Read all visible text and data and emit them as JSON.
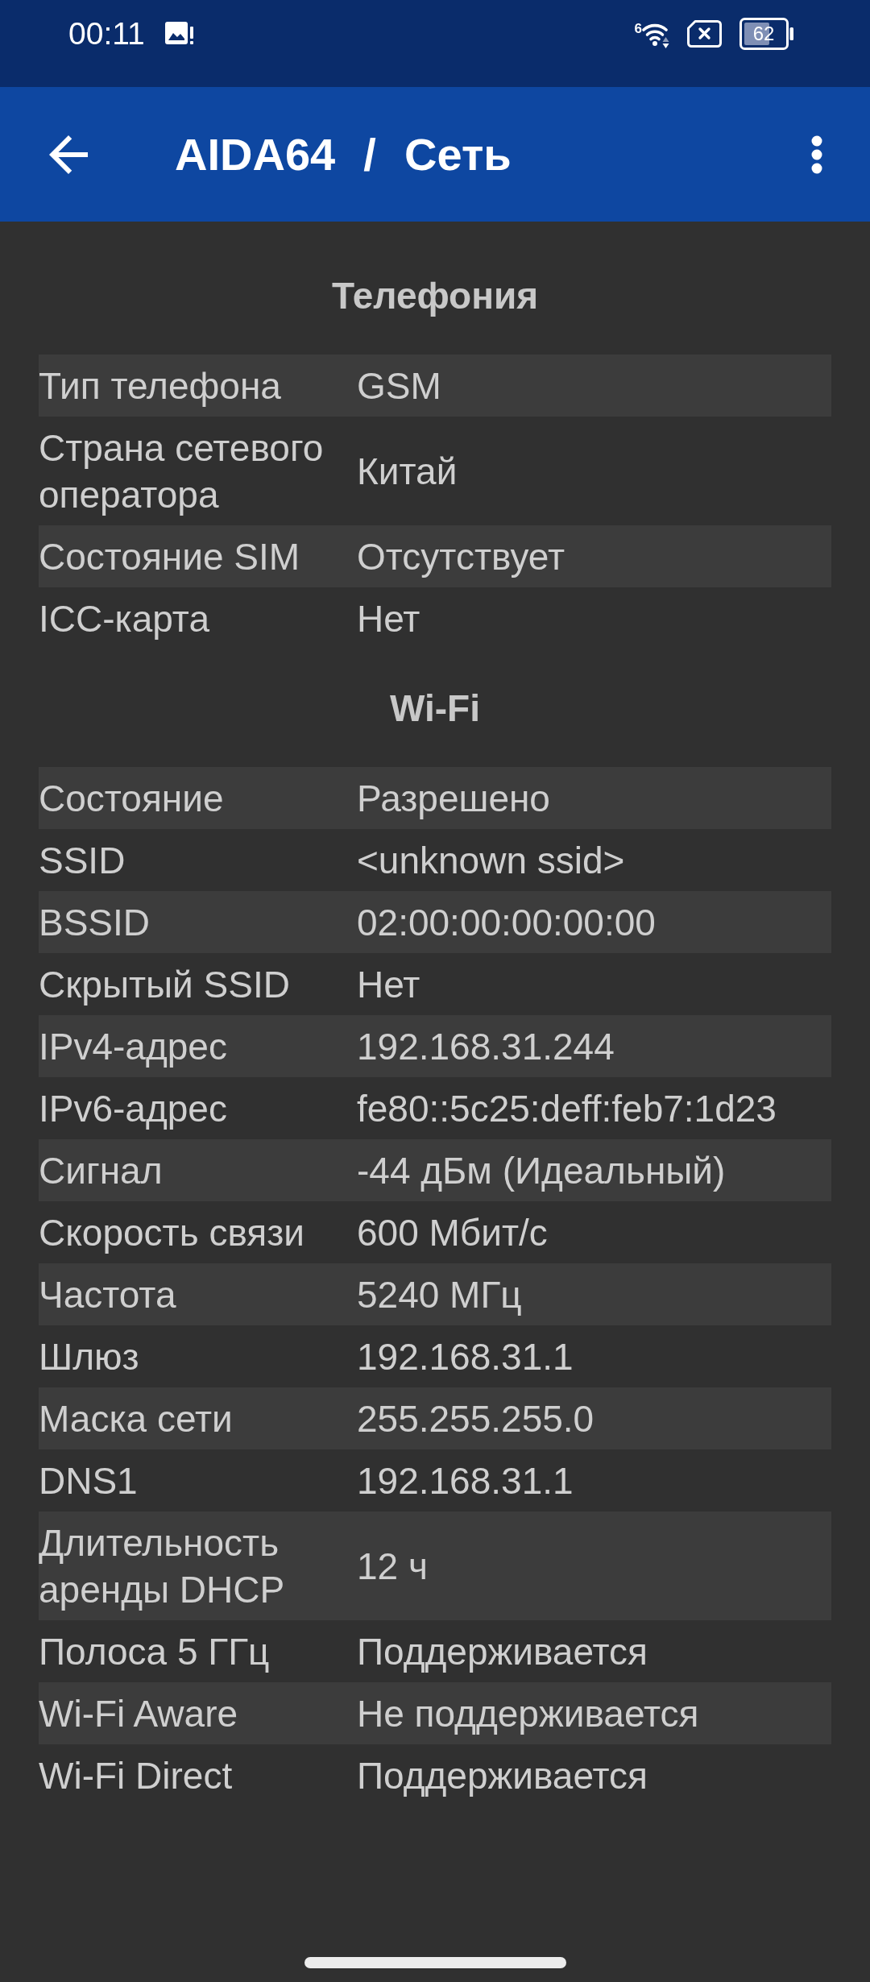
{
  "status_bar": {
    "time": "00:11",
    "wifi_badge": "6",
    "battery": "62"
  },
  "app_bar": {
    "title": "AIDA64 / Сеть"
  },
  "sections": [
    {
      "title": "Телефония",
      "rows": [
        {
          "label": "Тип телефона",
          "value": "GSM"
        },
        {
          "label": "Страна сетевого оператора",
          "value": "Китай"
        },
        {
          "label": "Состояние SIM",
          "value": "Отсутствует"
        },
        {
          "label": "ICC-карта",
          "value": "Нет"
        }
      ]
    },
    {
      "title": "Wi-Fi",
      "rows": [
        {
          "label": "Состояние",
          "value": "Разрешено"
        },
        {
          "label": "SSID",
          "value": "<unknown ssid>"
        },
        {
          "label": "BSSID",
          "value": "02:00:00:00:00:00"
        },
        {
          "label": "Скрытый SSID",
          "value": "Нет"
        },
        {
          "label": "IPv4-адрес",
          "value": "192.168.31.244"
        },
        {
          "label": "IPv6-адрес",
          "value": "fe80::5c25:deff:feb7:1d23"
        },
        {
          "label": "Сигнал",
          "value": "-44 дБм (Идеальный)"
        },
        {
          "label": "Скорость связи",
          "value": "600 Мбит/с"
        },
        {
          "label": "Частота",
          "value": "5240 МГц"
        },
        {
          "label": "Шлюз",
          "value": "192.168.31.1"
        },
        {
          "label": "Маска сети",
          "value": "255.255.255.0"
        },
        {
          "label": "DNS1",
          "value": "192.168.31.1"
        },
        {
          "label": "Длительность аренды DHCP",
          "value": "12 ч"
        },
        {
          "label": "Полоса 5 ГГц",
          "value": "Поддерживается"
        },
        {
          "label": "Wi-Fi Aware",
          "value": "Не поддерживается"
        },
        {
          "label": "Wi-Fi Direct",
          "value": "Поддерживается"
        }
      ]
    }
  ]
}
